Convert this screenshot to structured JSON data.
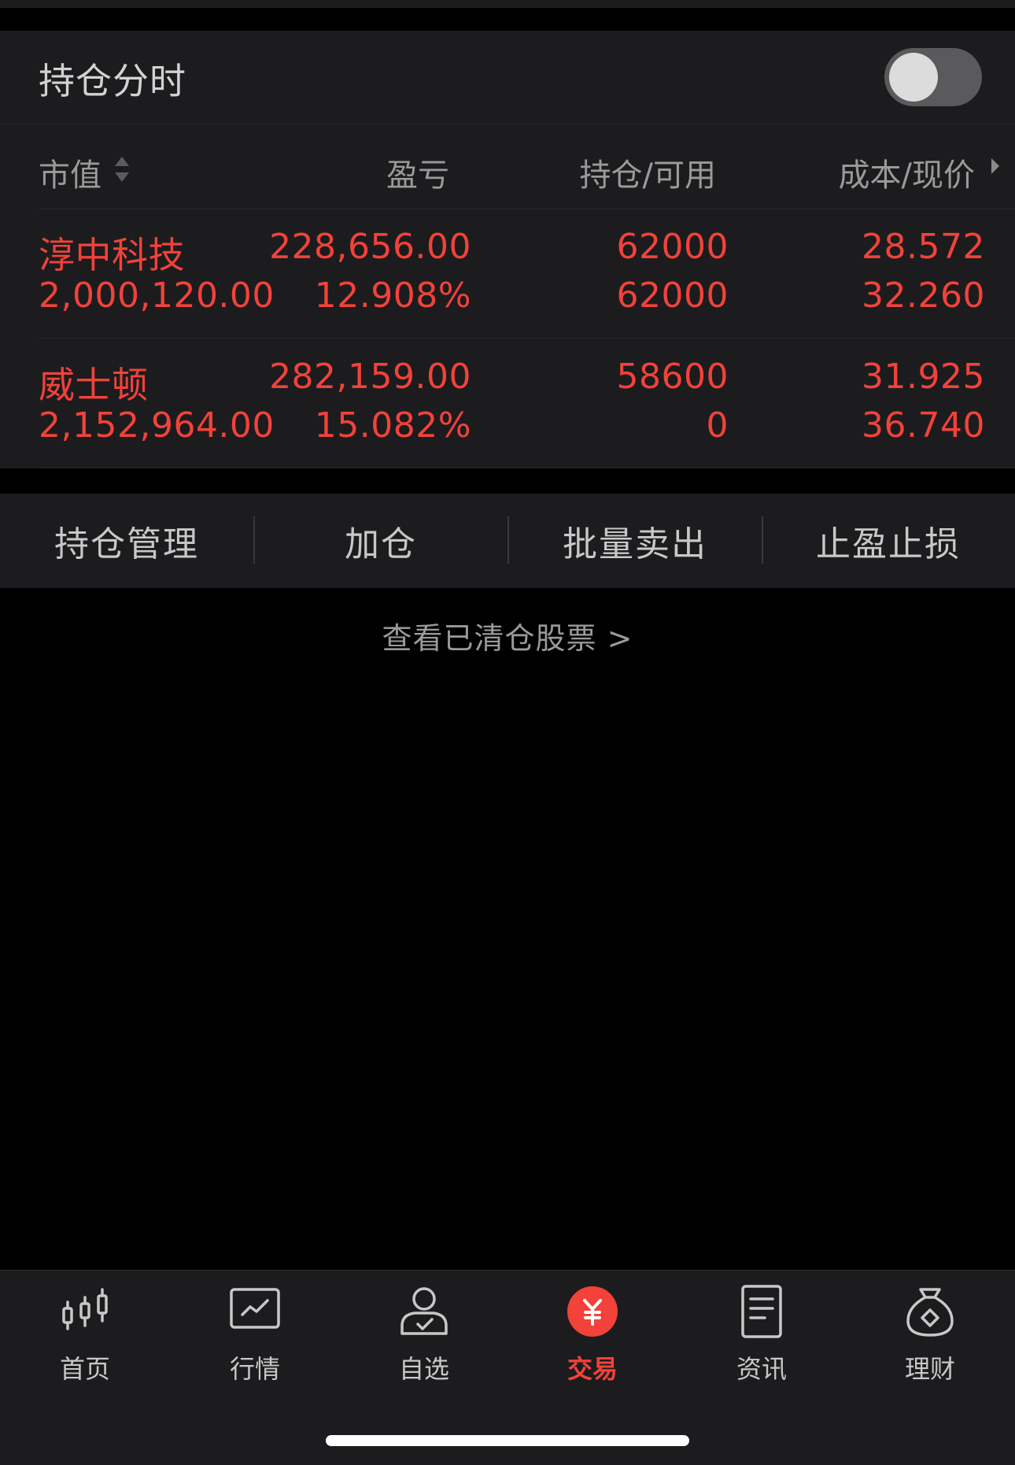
{
  "toggle_row": {
    "title": "持仓分时",
    "enabled": false
  },
  "table": {
    "headers": {
      "market_value": "市值",
      "profit_loss": "盈亏",
      "position_available": "持仓/可用",
      "cost_price": "成本/现价"
    },
    "rows": [
      {
        "name": "淳中科技",
        "market_value": "2,000,120.00",
        "pl_amount": "228,656.00",
        "pl_percent": "12.908%",
        "position": "62000",
        "available": "62000",
        "cost": "28.572",
        "price": "32.260"
      },
      {
        "name": "威士顿",
        "market_value": "2,152,964.00",
        "pl_amount": "282,159.00",
        "pl_percent": "15.082%",
        "position": "58600",
        "available": "0",
        "cost": "31.925",
        "price": "36.740"
      }
    ]
  },
  "actions": [
    "持仓管理",
    "加仓",
    "批量卖出",
    "止盈止损"
  ],
  "cleared_link": "查看已清仓股票 >",
  "tabbar": {
    "active": "交易",
    "items": [
      {
        "label": "首页",
        "icon": "candlestick-icon"
      },
      {
        "label": "行情",
        "icon": "chart-line-icon"
      },
      {
        "label": "自选",
        "icon": "user-check-icon"
      },
      {
        "label": "交易",
        "icon": "yuan-circle-icon"
      },
      {
        "label": "资讯",
        "icon": "document-icon"
      },
      {
        "label": "理财",
        "icon": "money-bag-icon"
      }
    ]
  },
  "colors": {
    "accent_red": "#f2423a",
    "panel_bg": "#1c1c1e",
    "page_bg": "#000000",
    "muted_text": "#9a9a9a"
  }
}
